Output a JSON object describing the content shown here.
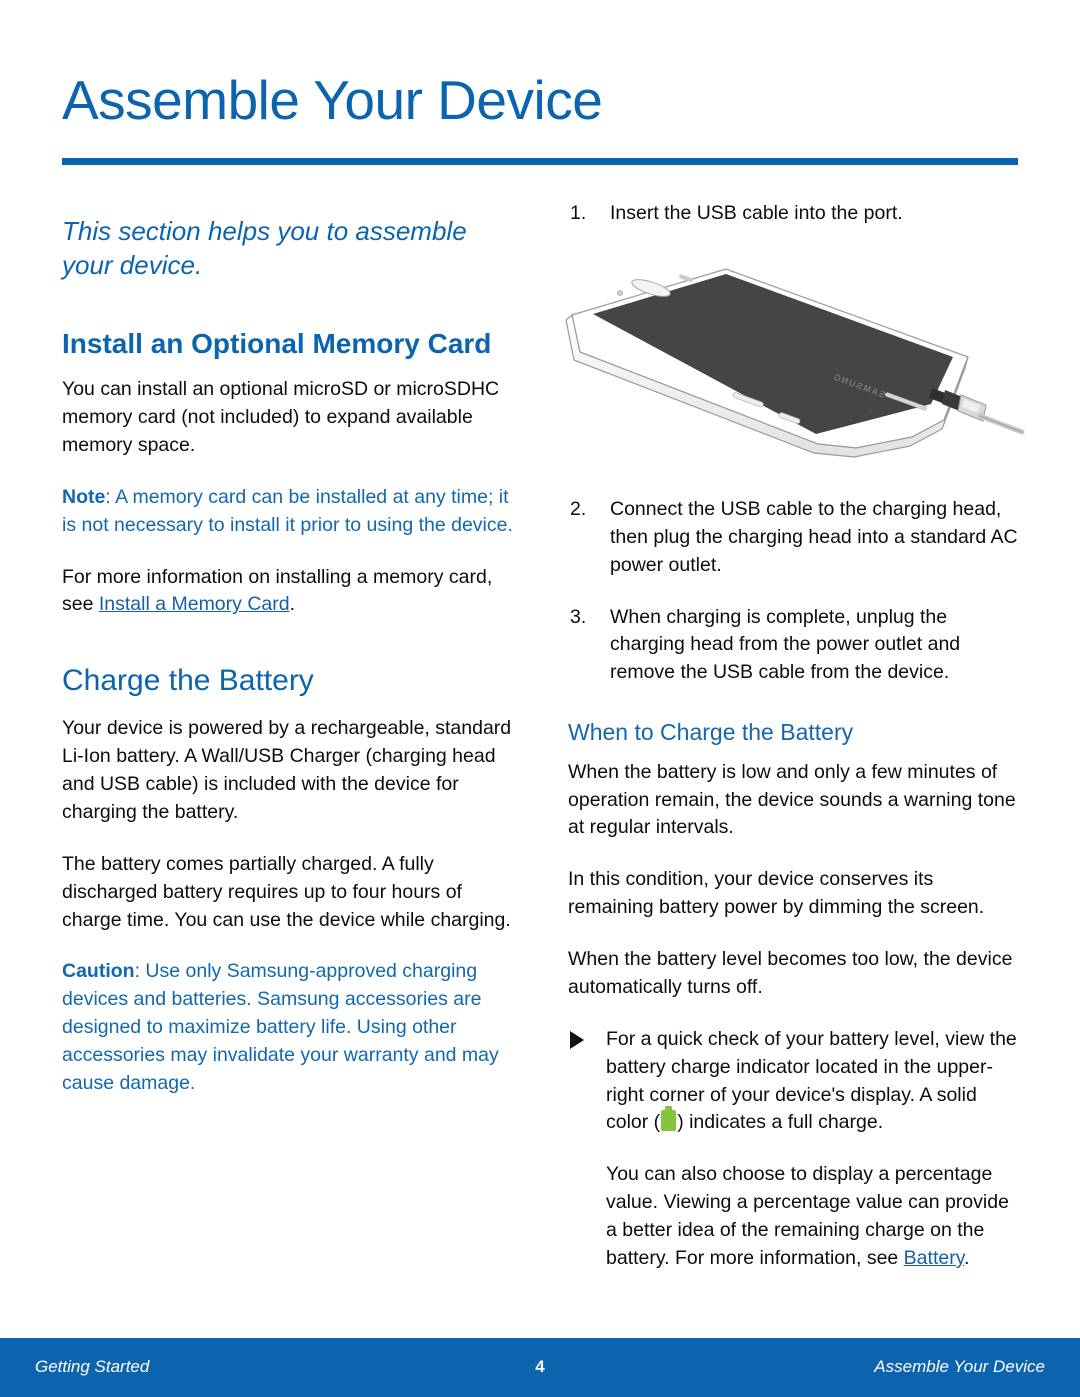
{
  "header": {
    "title": "Assemble Your Device",
    "rule_color": "#0b64ad"
  },
  "colors": {
    "brand_blue": "#0b64ad",
    "link_blue": "#1560a8",
    "note_blue": "#1268ad",
    "battery_green": "#86c440"
  },
  "left_column": {
    "lead": "This section helps you to assemble your device.",
    "memory_card": {
      "heading": "Install an Optional Memory Card",
      "paragraph": "You can install an optional microSD or microSDHC memory card (not included) to expand available memory space.",
      "note_label": "Note",
      "note_text": ": A memory card can be installed at any time; it is not necessary to install it prior to using the device.",
      "more_info_prefix": "For more information on installing a memory card, see ",
      "more_info_link": "Install a Memory Card",
      "more_info_suffix": "."
    },
    "charge_battery": {
      "heading": "Charge the Battery",
      "paragraph_1": "Your device is powered by a rechargeable, standard Li-Ion battery. A Wall/USB Charger (charging head and USB cable) is included with the device for charging the battery.",
      "paragraph_2": "The battery comes partially charged. A fully discharged battery requires up to four hours of charge time. You can use the device while charging.",
      "caution_label": "Caution",
      "caution_text": ": Use only Samsung-approved charging devices and batteries. Samsung accessories are designed to maximize battery life. Using other accessories may invalidate your warranty and may cause damage."
    }
  },
  "right_column": {
    "steps": [
      {
        "num": "1.",
        "text": "Insert the USB cable into the port."
      },
      {
        "num": "2.",
        "text": "Connect the USB cable to the charging head, then plug the charging head into a standard AC power outlet."
      },
      {
        "num": "3.",
        "text": "When charging is complete, unplug the charging head from the power outlet and remove the USB cable from the device."
      }
    ],
    "illustration_alt": "Samsung tablet with USB cable being inserted into the charging port",
    "when_to_charge": {
      "heading": "When to Charge the Battery",
      "paragraph_1": "When the battery is low and only a few minutes of operation remain, the device sounds a warning tone at regular intervals.",
      "paragraph_2": "In this condition, your device conserves its remaining battery power by dimming the screen.",
      "paragraph_3": "When the battery level becomes too low, the device automatically turns off.",
      "bullet_part_1": "For a quick check of your battery level, view the battery charge indicator located in the upper-right corner of your device's display. A solid color (",
      "bullet_part_2": ") indicates a full charge.",
      "final_prefix": "You can also choose to display a percentage value. Viewing a percentage value can provide a better idea of the remaining charge on the battery. For more information, see ",
      "final_link": "Battery",
      "final_suffix": "."
    }
  },
  "footer": {
    "left": "Getting Started",
    "page_number": "4",
    "right": "Assemble Your Device"
  }
}
